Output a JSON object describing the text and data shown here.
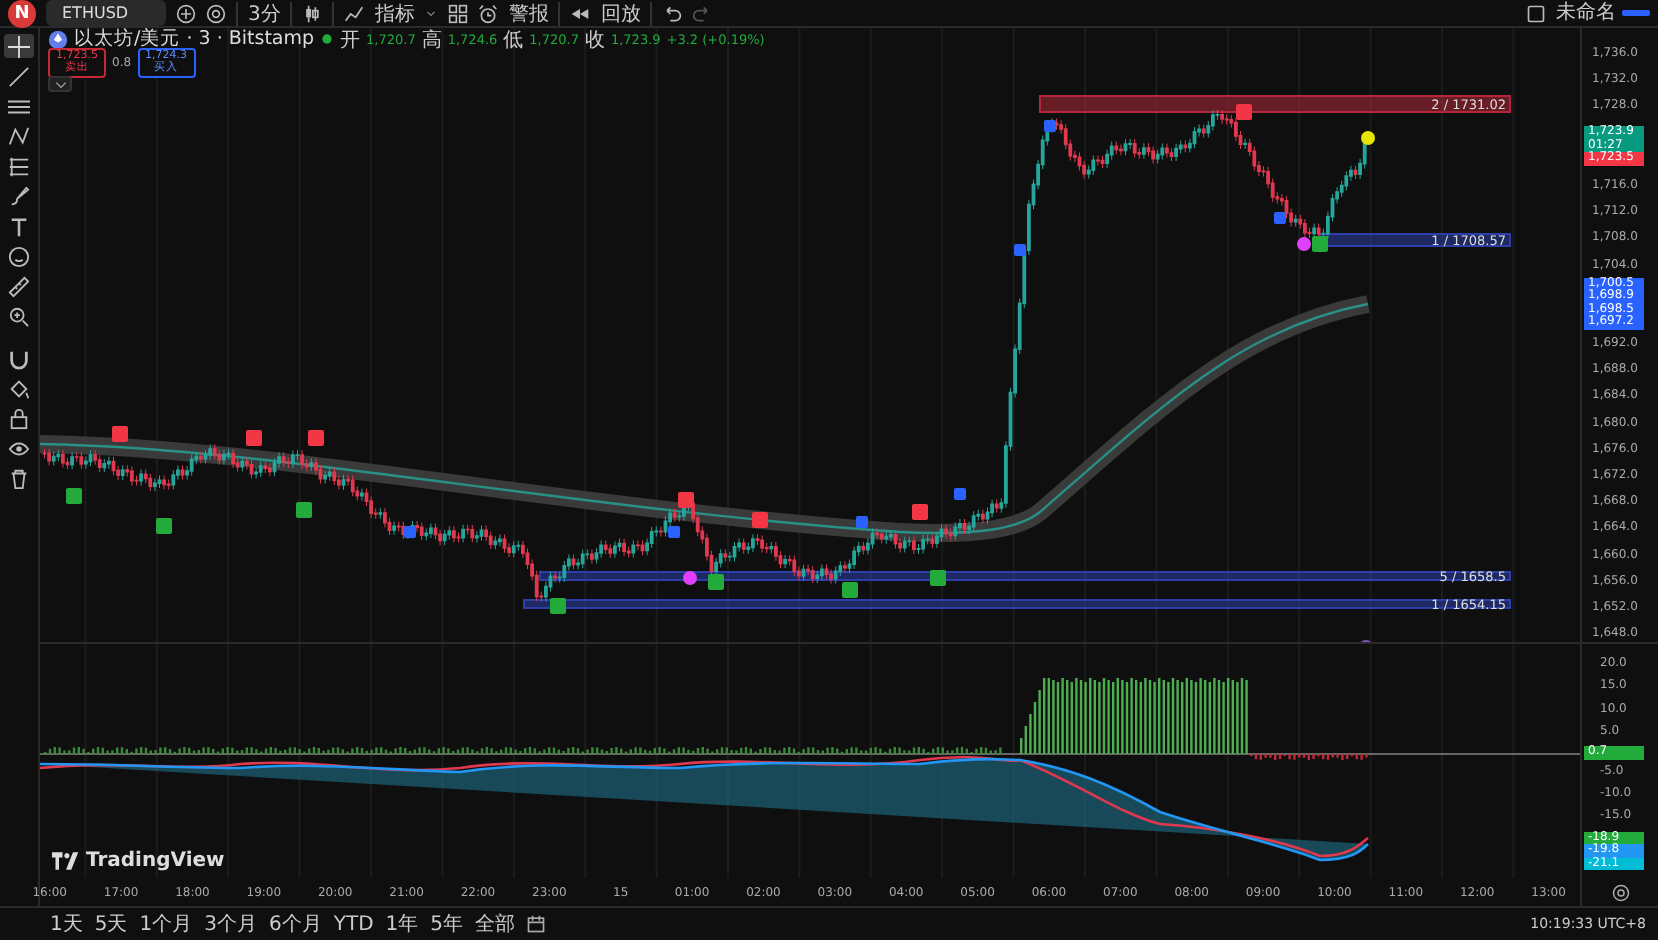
{
  "toolbar": {
    "avatar": "N",
    "symbol": "ETHUSD",
    "interval": "3分",
    "indicators": "指标",
    "alerts": "警报",
    "replay": "回放",
    "layout_name": "未命名"
  },
  "left_tools": [
    {
      "kind": "crosshair",
      "selected": true
    },
    {
      "kind": "trendline",
      "selected": false
    },
    {
      "kind": "lines",
      "selected": false
    },
    {
      "kind": "pattern",
      "selected": false
    },
    {
      "kind": "fib",
      "selected": false
    },
    {
      "kind": "brush",
      "selected": false
    },
    {
      "kind": "text",
      "selected": false
    },
    {
      "kind": "emoji",
      "selected": false
    },
    {
      "kind": "ruler",
      "selected": false
    },
    {
      "kind": "zoom",
      "selected": false
    },
    {
      "kind": "magnet",
      "selected": false
    },
    {
      "kind": "paint",
      "selected": false
    },
    {
      "kind": "lock",
      "selected": false
    },
    {
      "kind": "eye",
      "selected": false
    },
    {
      "kind": "trash",
      "selected": false
    }
  ],
  "legend": {
    "title": "以太坊/美元 · 3 · Bitstamp",
    "ohlc": [
      {
        "label": "开",
        "value": "1,720.7"
      },
      {
        "label": "高",
        "value": "1,724.6"
      },
      {
        "label": "低",
        "value": "1,720.7"
      },
      {
        "label": "收",
        "value": "1,723.9"
      }
    ],
    "change": "+3.2 (+0.19%)",
    "sell": {
      "price": "1,723.5",
      "label": "卖出"
    },
    "spread": "0.8",
    "buy": {
      "price": "1,724.3",
      "label": "买入"
    }
  },
  "price_levels": [
    {
      "label": "2 / 1731.02",
      "color": "#b2283a"
    },
    {
      "label": "1 / 1708.57",
      "color": "#2c3fa8"
    },
    {
      "label": "5 / 1658.5",
      "color": "#2c3fa8"
    },
    {
      "label": "1 / 1654.15",
      "color": "#2c3fa8"
    }
  ],
  "logo": "TradingView",
  "price_axis": [
    {
      "kind": "tick",
      "label": "1,736.0"
    },
    {
      "kind": "tick",
      "label": "1,732.0"
    },
    {
      "kind": "tick",
      "label": "1,728.0"
    },
    {
      "kind": "badges",
      "badges": [
        {
          "text": "1,723.9",
          "color": "#089981"
        },
        {
          "text": "01:27",
          "color": "#089981"
        },
        {
          "text": "1,723.5",
          "color": "#f23645"
        }
      ]
    },
    {
      "kind": "tick",
      "label": "1,716.0"
    },
    {
      "kind": "tick",
      "label": "1,712.0"
    },
    {
      "kind": "tick",
      "label": "1,708.0"
    },
    {
      "kind": "tick",
      "label": "1,704.0"
    },
    {
      "kind": "badges",
      "badges": [
        {
          "text": "1,700.5",
          "color": "#2962ff"
        },
        {
          "text": "1,698.9",
          "color": "#2962ff"
        },
        {
          "text": "1,698.5",
          "color": "#2962ff"
        },
        {
          "text": "1,697.2",
          "color": "#2962ff"
        }
      ]
    },
    {
      "kind": "tick",
      "label": "1,692.0"
    },
    {
      "kind": "tick",
      "label": "1,688.0"
    },
    {
      "kind": "tick",
      "label": "1,684.0"
    },
    {
      "kind": "tick",
      "label": "1,680.0"
    },
    {
      "kind": "tick",
      "label": "1,676.0"
    },
    {
      "kind": "tick",
      "label": "1,672.0"
    },
    {
      "kind": "tick",
      "label": "1,668.0"
    },
    {
      "kind": "tick",
      "label": "1,664.0"
    },
    {
      "kind": "tick",
      "label": "1,660.0"
    },
    {
      "kind": "tick",
      "label": "1,656.0"
    },
    {
      "kind": "tick",
      "label": "1,652.0"
    },
    {
      "kind": "tick",
      "label": "1,648.0"
    }
  ],
  "oscillator_axis": [
    {
      "kind": "tick",
      "label": "20.0"
    },
    {
      "kind": "tick",
      "label": "15.0"
    },
    {
      "kind": "tick",
      "label": "10.0"
    },
    {
      "kind": "tick",
      "label": "5.0"
    },
    {
      "kind": "badges",
      "badges": [
        {
          "text": "0.7",
          "color": "#22ab3b"
        }
      ]
    },
    {
      "kind": "tick",
      "label": "-5.0"
    },
    {
      "kind": "tick",
      "label": "-10.0"
    },
    {
      "kind": "tick",
      "label": "-15.0"
    },
    {
      "kind": "badges",
      "badges": [
        {
          "text": "-18.9",
          "color": "#22ab3b"
        },
        {
          "text": "-19.8",
          "color": "#2196f3"
        },
        {
          "text": "-21.1",
          "color": "#00bcd4"
        }
      ]
    }
  ],
  "time_axis": [
    "16:00",
    "17:00",
    "18:00",
    "19:00",
    "20:00",
    "21:00",
    "22:00",
    "23:00",
    "15",
    "01:00",
    "02:00",
    "03:00",
    "04:00",
    "05:00",
    "06:00",
    "07:00",
    "08:00",
    "09:00",
    "10:00",
    "11:00",
    "12:00",
    "13:00"
  ],
  "ranges": [
    "1天",
    "5天",
    "1个月",
    "3个月",
    "6个月",
    "YTD",
    "1年",
    "5年",
    "全部"
  ],
  "clock": "10:19:33 UTC+8"
}
